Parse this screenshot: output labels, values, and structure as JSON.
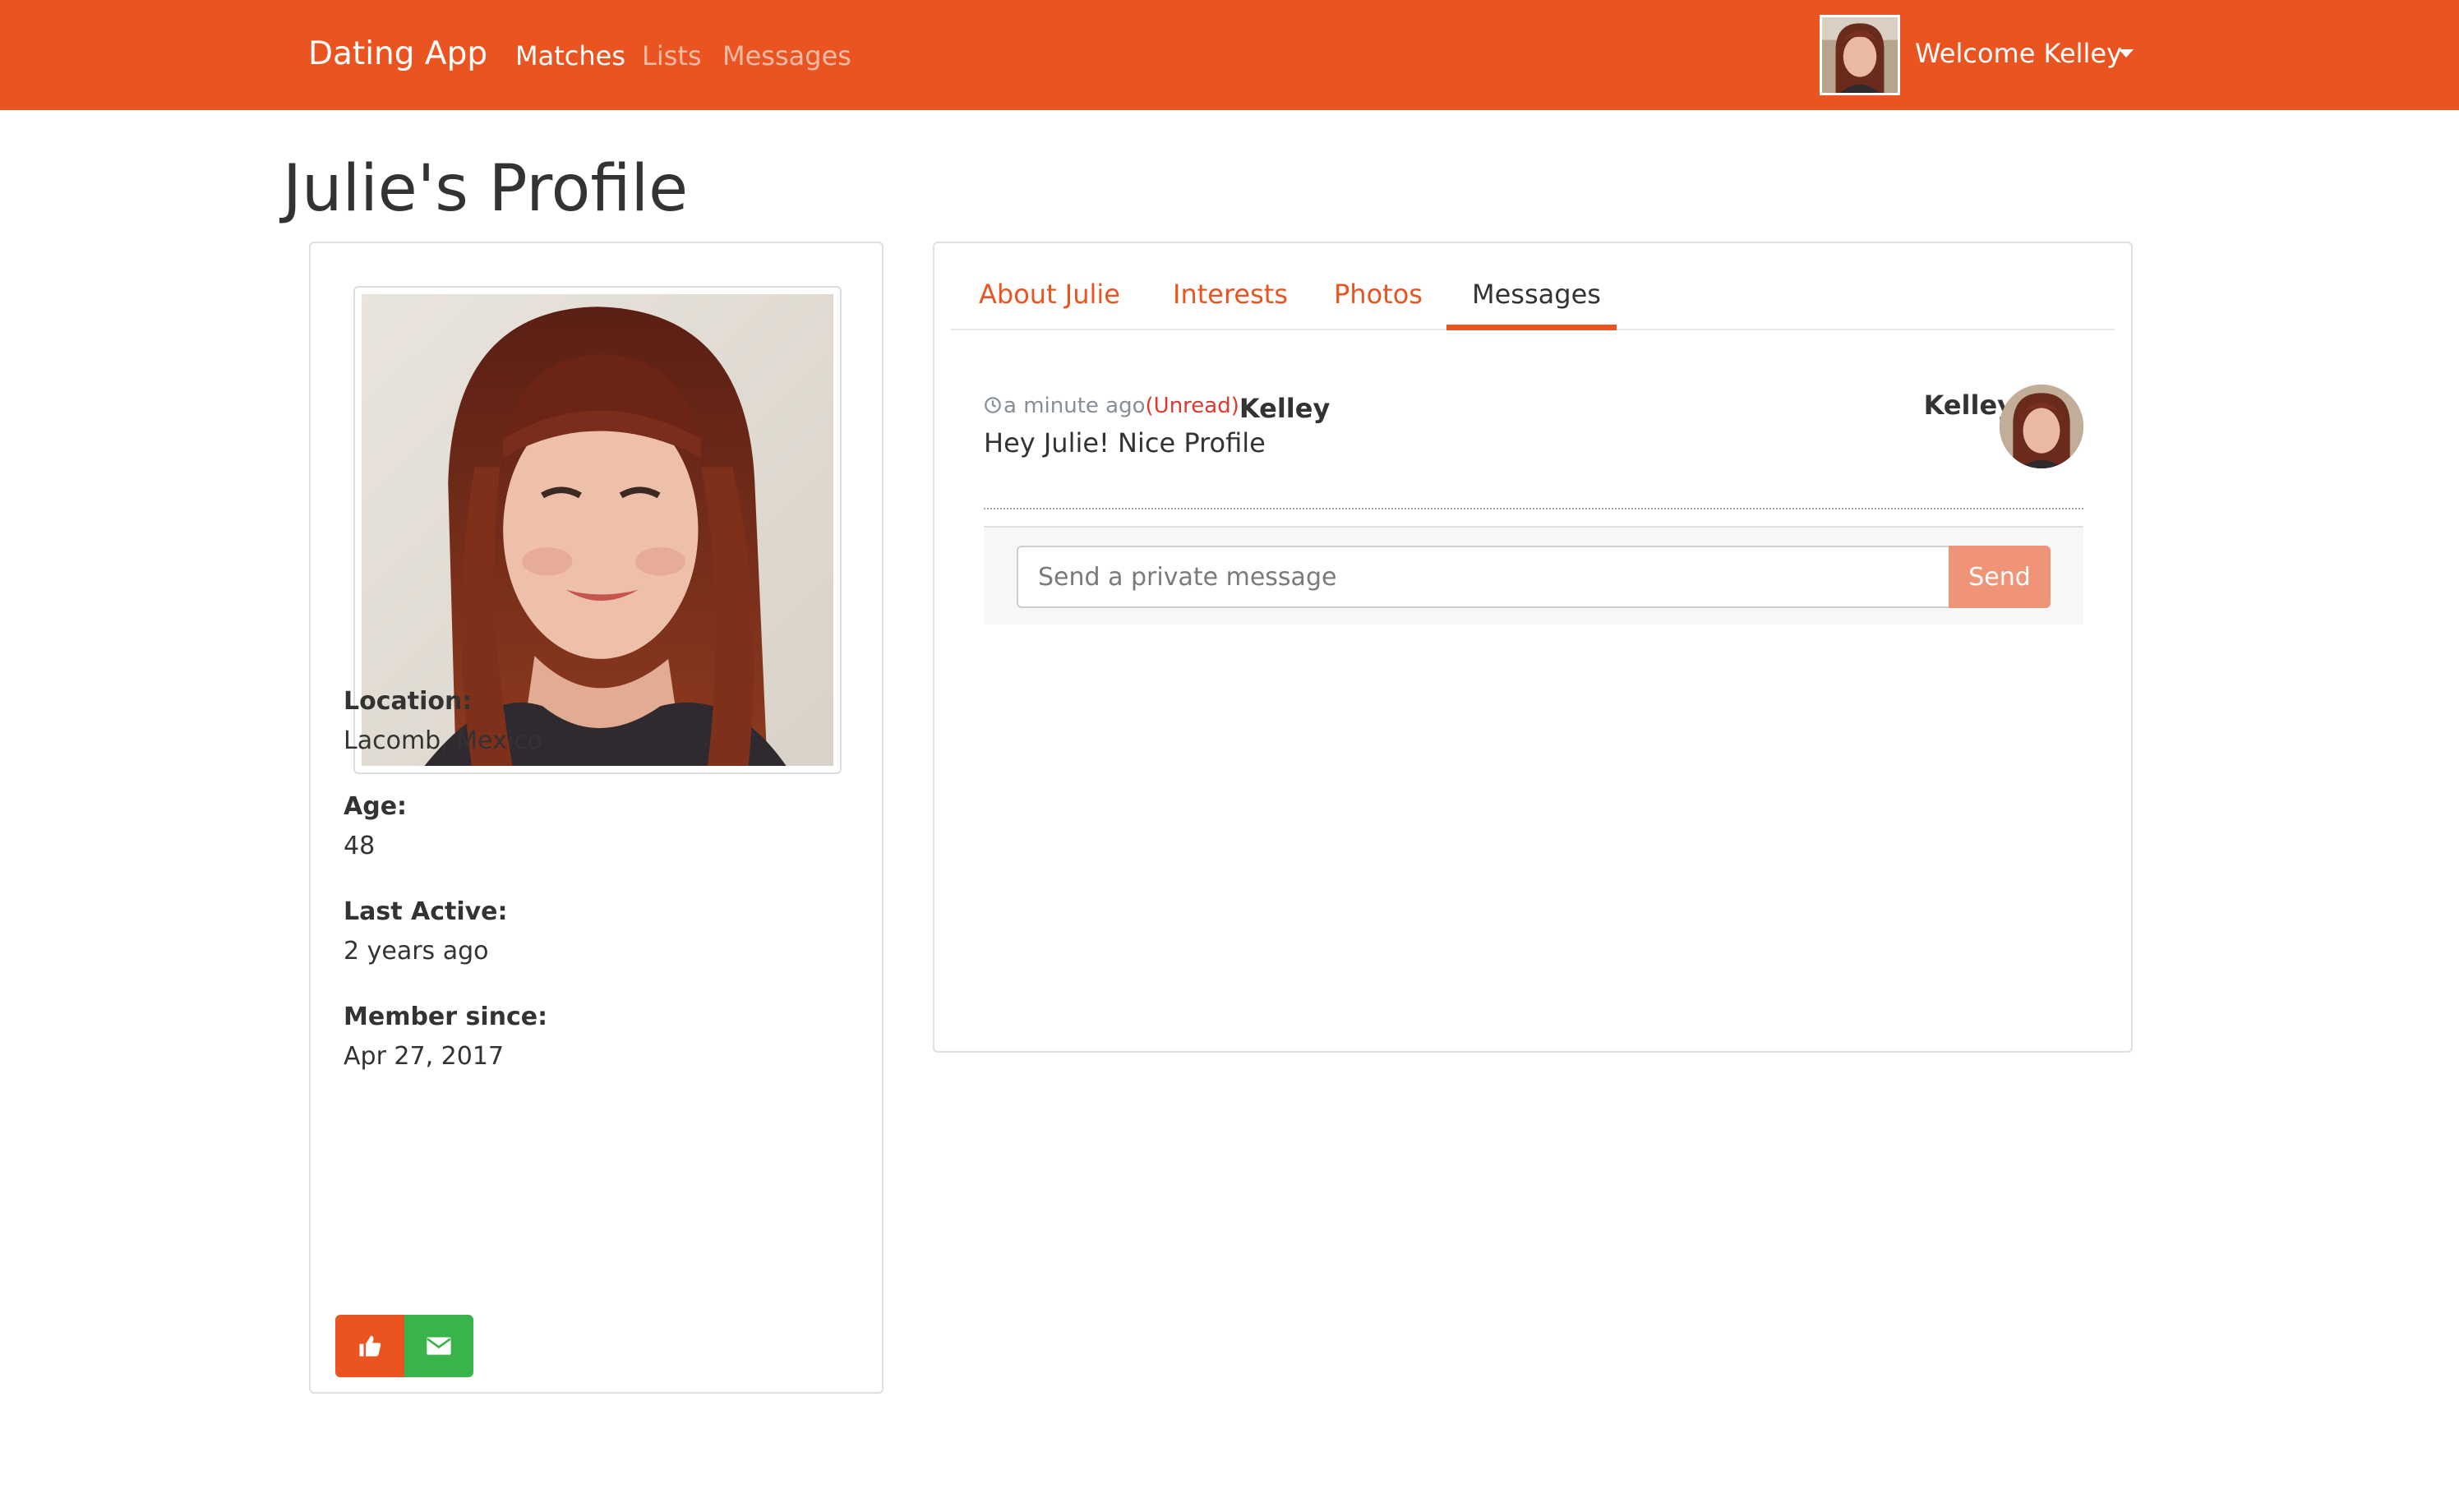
{
  "navbar": {
    "brand": "Dating App",
    "links": [
      {
        "label": "Matches",
        "active": true
      },
      {
        "label": "Lists",
        "active": false
      },
      {
        "label": "Messages",
        "active": false
      }
    ],
    "welcome": "Welcome Kelley",
    "accent_color": "#e95420"
  },
  "page": {
    "title": "Julie's Profile"
  },
  "profile": {
    "fields": [
      {
        "label": "Location:",
        "value": "Lacomb, Mexico"
      },
      {
        "label": "Age:",
        "value": "48"
      },
      {
        "label": "Last Active:",
        "value": "2 years ago"
      },
      {
        "label": "Member since:",
        "value": "Apr 27, 2017"
      }
    ],
    "actions": [
      {
        "icon": "thumbs-up-icon",
        "color": "#e95420"
      },
      {
        "icon": "envelope-icon",
        "color": "#38b44a"
      }
    ]
  },
  "tabs": [
    {
      "label": "About Julie",
      "active": false
    },
    {
      "label": "Interests",
      "active": false
    },
    {
      "label": "Photos",
      "active": false
    },
    {
      "label": "Messages",
      "active": true
    }
  ],
  "messages": [
    {
      "time": "a minute ago",
      "status": "(Unread)",
      "sender": "Kelley",
      "text": "Hey Julie! Nice Profile",
      "author_label": "Kelley"
    }
  ],
  "composer": {
    "placeholder": "Send a private message",
    "send_label": "Send"
  }
}
